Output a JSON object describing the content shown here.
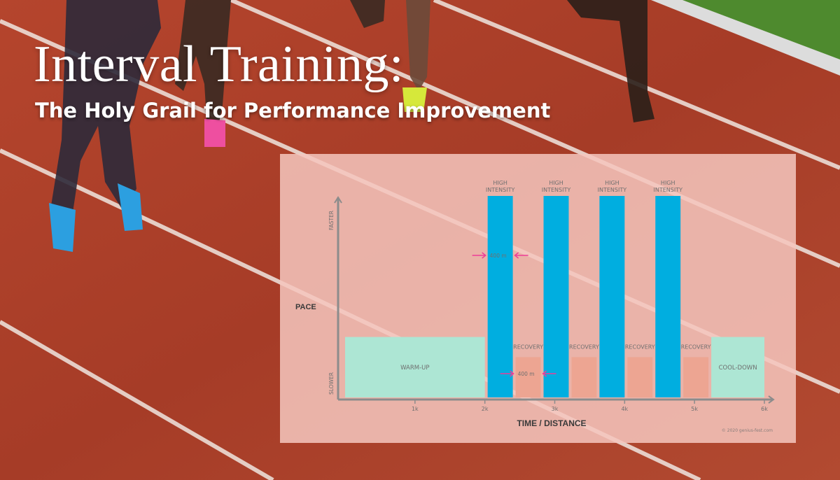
{
  "header": {
    "title": "Interval Training:",
    "subtitle": "The Holy Grail for Performance Improvement"
  },
  "chart_data": {
    "type": "bar",
    "xlabel": "TIME / DISTANCE",
    "ylabel": "PACE",
    "y_tick_labels": [
      "SLOWER",
      "FASTER"
    ],
    "x_ticks": [
      "1k",
      "2k",
      "3k",
      "4k",
      "5k",
      "6k"
    ],
    "xlim": [
      0,
      6
    ],
    "y_scale": "qualitative (slower to faster)",
    "grid": false,
    "segments": [
      {
        "label": "WARM-UP",
        "start": 0,
        "end": 2,
        "intensity": 0.3,
        "kind": "warmup"
      },
      {
        "label": "HIGH INTENSITY",
        "start": 2.04,
        "end": 2.4,
        "intensity": 1.0,
        "kind": "high"
      },
      {
        "label": "RECOVERY",
        "start": 2.44,
        "end": 2.8,
        "intensity": 0.2,
        "kind": "recovery"
      },
      {
        "label": "HIGH INTENSITY",
        "start": 2.84,
        "end": 3.2,
        "intensity": 1.0,
        "kind": "high"
      },
      {
        "label": "RECOVERY",
        "start": 3.24,
        "end": 3.6,
        "intensity": 0.2,
        "kind": "recovery"
      },
      {
        "label": "HIGH INTENSITY",
        "start": 3.64,
        "end": 4.0,
        "intensity": 1.0,
        "kind": "high"
      },
      {
        "label": "RECOVERY",
        "start": 4.04,
        "end": 4.4,
        "intensity": 0.2,
        "kind": "recovery"
      },
      {
        "label": "HIGH INTENSITY",
        "start": 4.44,
        "end": 4.8,
        "intensity": 1.0,
        "kind": "high"
      },
      {
        "label": "RECOVERY",
        "start": 4.84,
        "end": 5.2,
        "intensity": 0.2,
        "kind": "recovery"
      },
      {
        "label": "COOL-DOWN",
        "start": 5.24,
        "end": 6,
        "intensity": 0.3,
        "kind": "cooldown"
      }
    ],
    "annotations": [
      {
        "text": "400 m",
        "segment_index": 1
      },
      {
        "text": "400 m",
        "segment_index": 2
      }
    ],
    "credit": "© 2020 genius-fest.com"
  },
  "colors": {
    "high": "#00aee0",
    "recovery": "#eda592",
    "warmup": "#ade6d4",
    "cooldown": "#ade6d4",
    "axis": "#8c8c8c",
    "arrow": "#ee3d97"
  }
}
